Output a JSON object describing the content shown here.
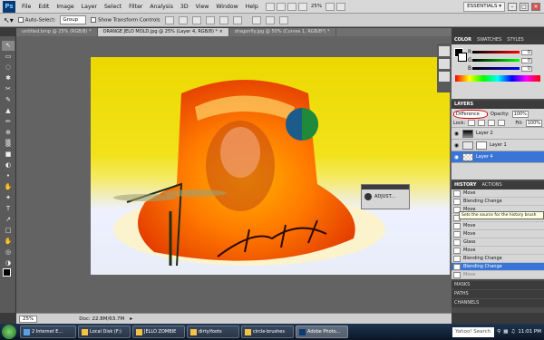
{
  "app": {
    "logo": "Ps"
  },
  "menu": [
    "File",
    "Edit",
    "Image",
    "Layer",
    "Select",
    "Filter",
    "Analysis",
    "3D",
    "View",
    "Window",
    "Help"
  ],
  "menu_right": {
    "zoom": "25%",
    "workspace": "ESSENTIALS ▾",
    "minimize": "–",
    "restore": "□",
    "close": "✕"
  },
  "options": {
    "auto_select_label": "Auto-Select:",
    "auto_select_value": "Group",
    "transform_label": "Show Transform Controls"
  },
  "tabs": [
    "untitled.bmp @ 25% (RGB/8) *",
    "ORANGE JELO MOLD.jpg @ 25% (Layer 4, RGB/8) * ×",
    "dragonfly.jpg @ 50% (Curves 1, RGB/8*) *"
  ],
  "tools": [
    "↖",
    "▭",
    "◌",
    "✱",
    "✂",
    "✎",
    "▲",
    "✏",
    "⊕",
    "▒",
    "■",
    "◐",
    "•",
    "✋",
    "✦",
    "T",
    "↗",
    "□",
    "✋",
    "◎",
    "◑",
    "⬛"
  ],
  "status": {
    "zoom": "25%",
    "doc": "Doc: 22.8M/63.7M"
  },
  "adjust_panel": {
    "label": "ADJUST..."
  },
  "color_panel": {
    "tabs": [
      "COLOR",
      "SWATCHES",
      "STYLES"
    ],
    "values": [
      "0",
      "0",
      "0"
    ]
  },
  "layers_panel": {
    "title": "LAYERS",
    "blend_mode": "Difference",
    "opacity_label": "Opacity:",
    "opacity": "100%",
    "lock_label": "Lock:",
    "fill_label": "Fill:",
    "fill": "100%",
    "layers": [
      {
        "name": "Layer 2",
        "active": false
      },
      {
        "name": "Layer 1",
        "active": false
      },
      {
        "name": "Layer 4",
        "active": true
      }
    ]
  },
  "history_panel": {
    "tabs": [
      "HISTORY",
      "ACTIONS"
    ],
    "items": [
      "Move",
      "Blending Change",
      "Move",
      "Elliptical Marquee",
      "Move",
      "Move",
      "Glass",
      "Move",
      "Blending Change",
      "Blending Change",
      "Move"
    ],
    "tooltip": "Sets the source for the history brush"
  },
  "bottom_panels": [
    "MASKS",
    "PATHS",
    "CHANNELS"
  ],
  "taskbar": {
    "items": [
      "2 Internet E...",
      "Local Disk (F:)",
      "JELLO ZOMBIE",
      "dirty/foots",
      "circle-brushes",
      "Adobe Photo..."
    ],
    "search": "Yahoo! Search",
    "time": "11:01 PM"
  }
}
